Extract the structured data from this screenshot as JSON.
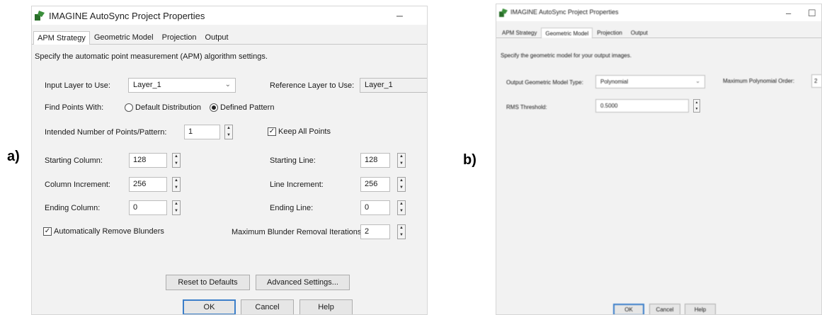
{
  "panels": {
    "a": {
      "letter": "a)",
      "title": "IMAGINE AutoSync Project Properties",
      "minimize_glyph": "–",
      "tabs": [
        "APM Strategy",
        "Geometric Model",
        "Projection",
        "Output"
      ],
      "active_tab": "APM Strategy",
      "description": "Specify the automatic point measurement (APM) algorithm settings.",
      "input_layer": {
        "label": "Input Layer to Use:",
        "value": "Layer_1"
      },
      "reference_layer": {
        "label": "Reference Layer to Use:",
        "value": "Layer_1"
      },
      "find_points": {
        "label": "Find Points With:",
        "options": [
          "Default Distribution",
          "Defined Pattern"
        ],
        "selected": "Defined Pattern"
      },
      "intended_points": {
        "label": "Intended Number of Points/Pattern:",
        "value": "1"
      },
      "keep_all_points": {
        "label": "Keep All Points",
        "checked": true
      },
      "starting_column": {
        "label": "Starting Column:",
        "value": "128"
      },
      "starting_line": {
        "label": "Starting Line:",
        "value": "128"
      },
      "column_increment": {
        "label": "Column Increment:",
        "value": "256"
      },
      "line_increment": {
        "label": "Line Increment:",
        "value": "256"
      },
      "ending_column": {
        "label": "Ending Column:",
        "value": "0"
      },
      "ending_line": {
        "label": "Ending Line:",
        "value": "0"
      },
      "auto_remove_blunders": {
        "label": "Automatically Remove Blunders",
        "checked": true
      },
      "max_blunder_iterations": {
        "label": "Maximum Blunder Removal Iterations:",
        "value": "2"
      },
      "buttons": {
        "reset": "Reset to Defaults",
        "advanced": "Advanced Settings...",
        "ok": "OK",
        "cancel": "Cancel",
        "help": "Help"
      }
    },
    "b": {
      "letter": "b)",
      "title": "IMAGINE AutoSync Project Properties",
      "minimize_glyph": "–",
      "maximize_glyph": "☐",
      "tabs": [
        "APM Strategy",
        "Geometric Model",
        "Projection",
        "Output"
      ],
      "active_tab": "Geometric Model",
      "description": "Specify the geometric model for your output images.",
      "output_model_type": {
        "label": "Output Geometric Model Type:",
        "value": "Polynomial"
      },
      "max_polynomial_order": {
        "label": "Maximum Polynomial Order:",
        "value": "2"
      },
      "rms_threshold": {
        "label": "RMS Threshold:",
        "value": "0.5000"
      },
      "buttons": {
        "ok": "OK",
        "cancel": "Cancel",
        "help": "Help"
      }
    }
  },
  "colors": {
    "dialog_bg": "#f2f2f2",
    "default_button_border": "#3c7fc9",
    "app_icon": "#2a6e2a"
  },
  "icons": {
    "app": "imagine-app-icon",
    "spin": "spin-arrows-icon",
    "dropdown": "chevron-down-icon"
  }
}
